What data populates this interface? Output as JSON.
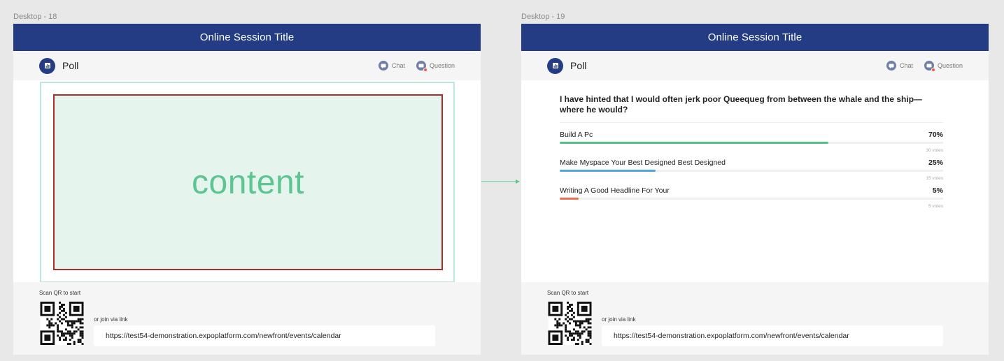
{
  "frames": [
    {
      "label": "Desktop - 18",
      "session_title": "Online Session Title",
      "poll_label": "Poll",
      "chat_label": "Chat",
      "question_label": "Question",
      "content_placeholder": "content",
      "scan_text": "Scan QR to start",
      "join_text": "or join via link",
      "link": "https://test54-demonstration.expoplatform.com/newfront/events/calendar"
    },
    {
      "label": "Desktop - 19",
      "session_title": "Online Session Title",
      "poll_label": "Poll",
      "chat_label": "Chat",
      "question_label": "Question",
      "scan_text": "Scan QR to start",
      "join_text": "or join via link",
      "link": "https://test54-demonstration.expoplatform.com/newfront/events/calendar",
      "poll": {
        "question": "I have hinted that I would often jerk poor Queequeg from between the whale and the ship—where he would?",
        "options": [
          {
            "label": "Build A Pc",
            "percent_text": "70%",
            "percent": 70,
            "votes_text": "30 votes",
            "color": "#56c085"
          },
          {
            "label": "Make Myspace Your Best Designed Best Designed",
            "percent_text": "25%",
            "percent": 25,
            "votes_text": "15 votes",
            "color": "#4ea6dc"
          },
          {
            "label": "Writing A Good Headline For Your",
            "percent_text": "5%",
            "percent": 5,
            "votes_text": "5 votes",
            "color": "#ee6e4d"
          }
        ]
      }
    }
  ],
  "colors": {
    "title_bar": "#233c83",
    "arrow": "#5cc592",
    "content_text": "#5cc592",
    "content_border": "#a9302a"
  },
  "icons": {
    "poll": "bar-chart-icon",
    "chat": "chat-icon",
    "question": "question-icon",
    "flow": "arrow-right-icon"
  }
}
